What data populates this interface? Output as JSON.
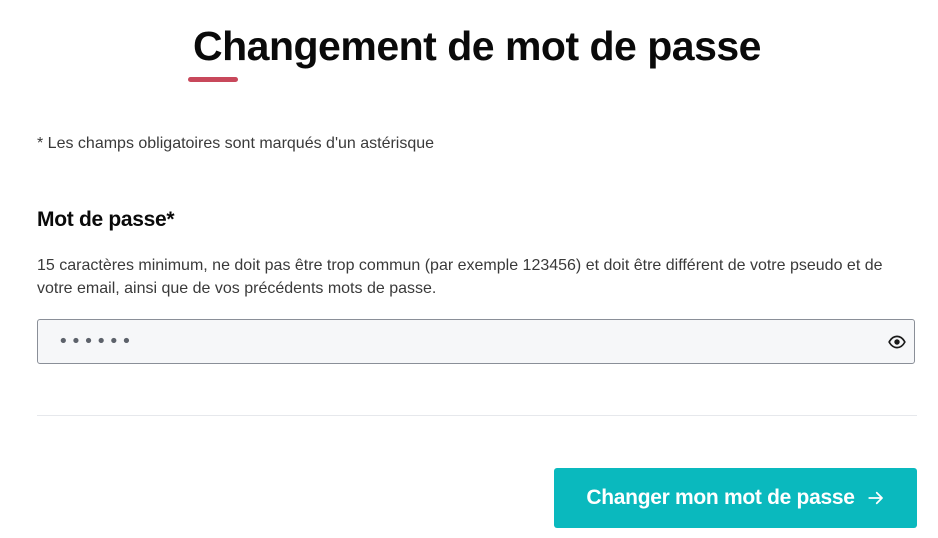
{
  "page": {
    "title": "Changement de mot de passe",
    "required_note": "* Les champs obligatoires sont marqués d'un astérisque"
  },
  "password_field": {
    "label": "Mot de passe*",
    "hint": "15 caractères minimum, ne doit pas être trop commun (par exemple 123456) et doit être différent de votre pseudo et de votre email, ainsi que de vos précédents mots de passe.",
    "value": "••••••",
    "toggle_icon": "eye-icon"
  },
  "actions": {
    "submit_label": "Changer mon mot de passe",
    "submit_icon": "arrow-right-icon"
  },
  "colors": {
    "accent_underline": "#c8485b",
    "primary_button": "#0ab9be",
    "input_background": "#f6f7f9"
  }
}
